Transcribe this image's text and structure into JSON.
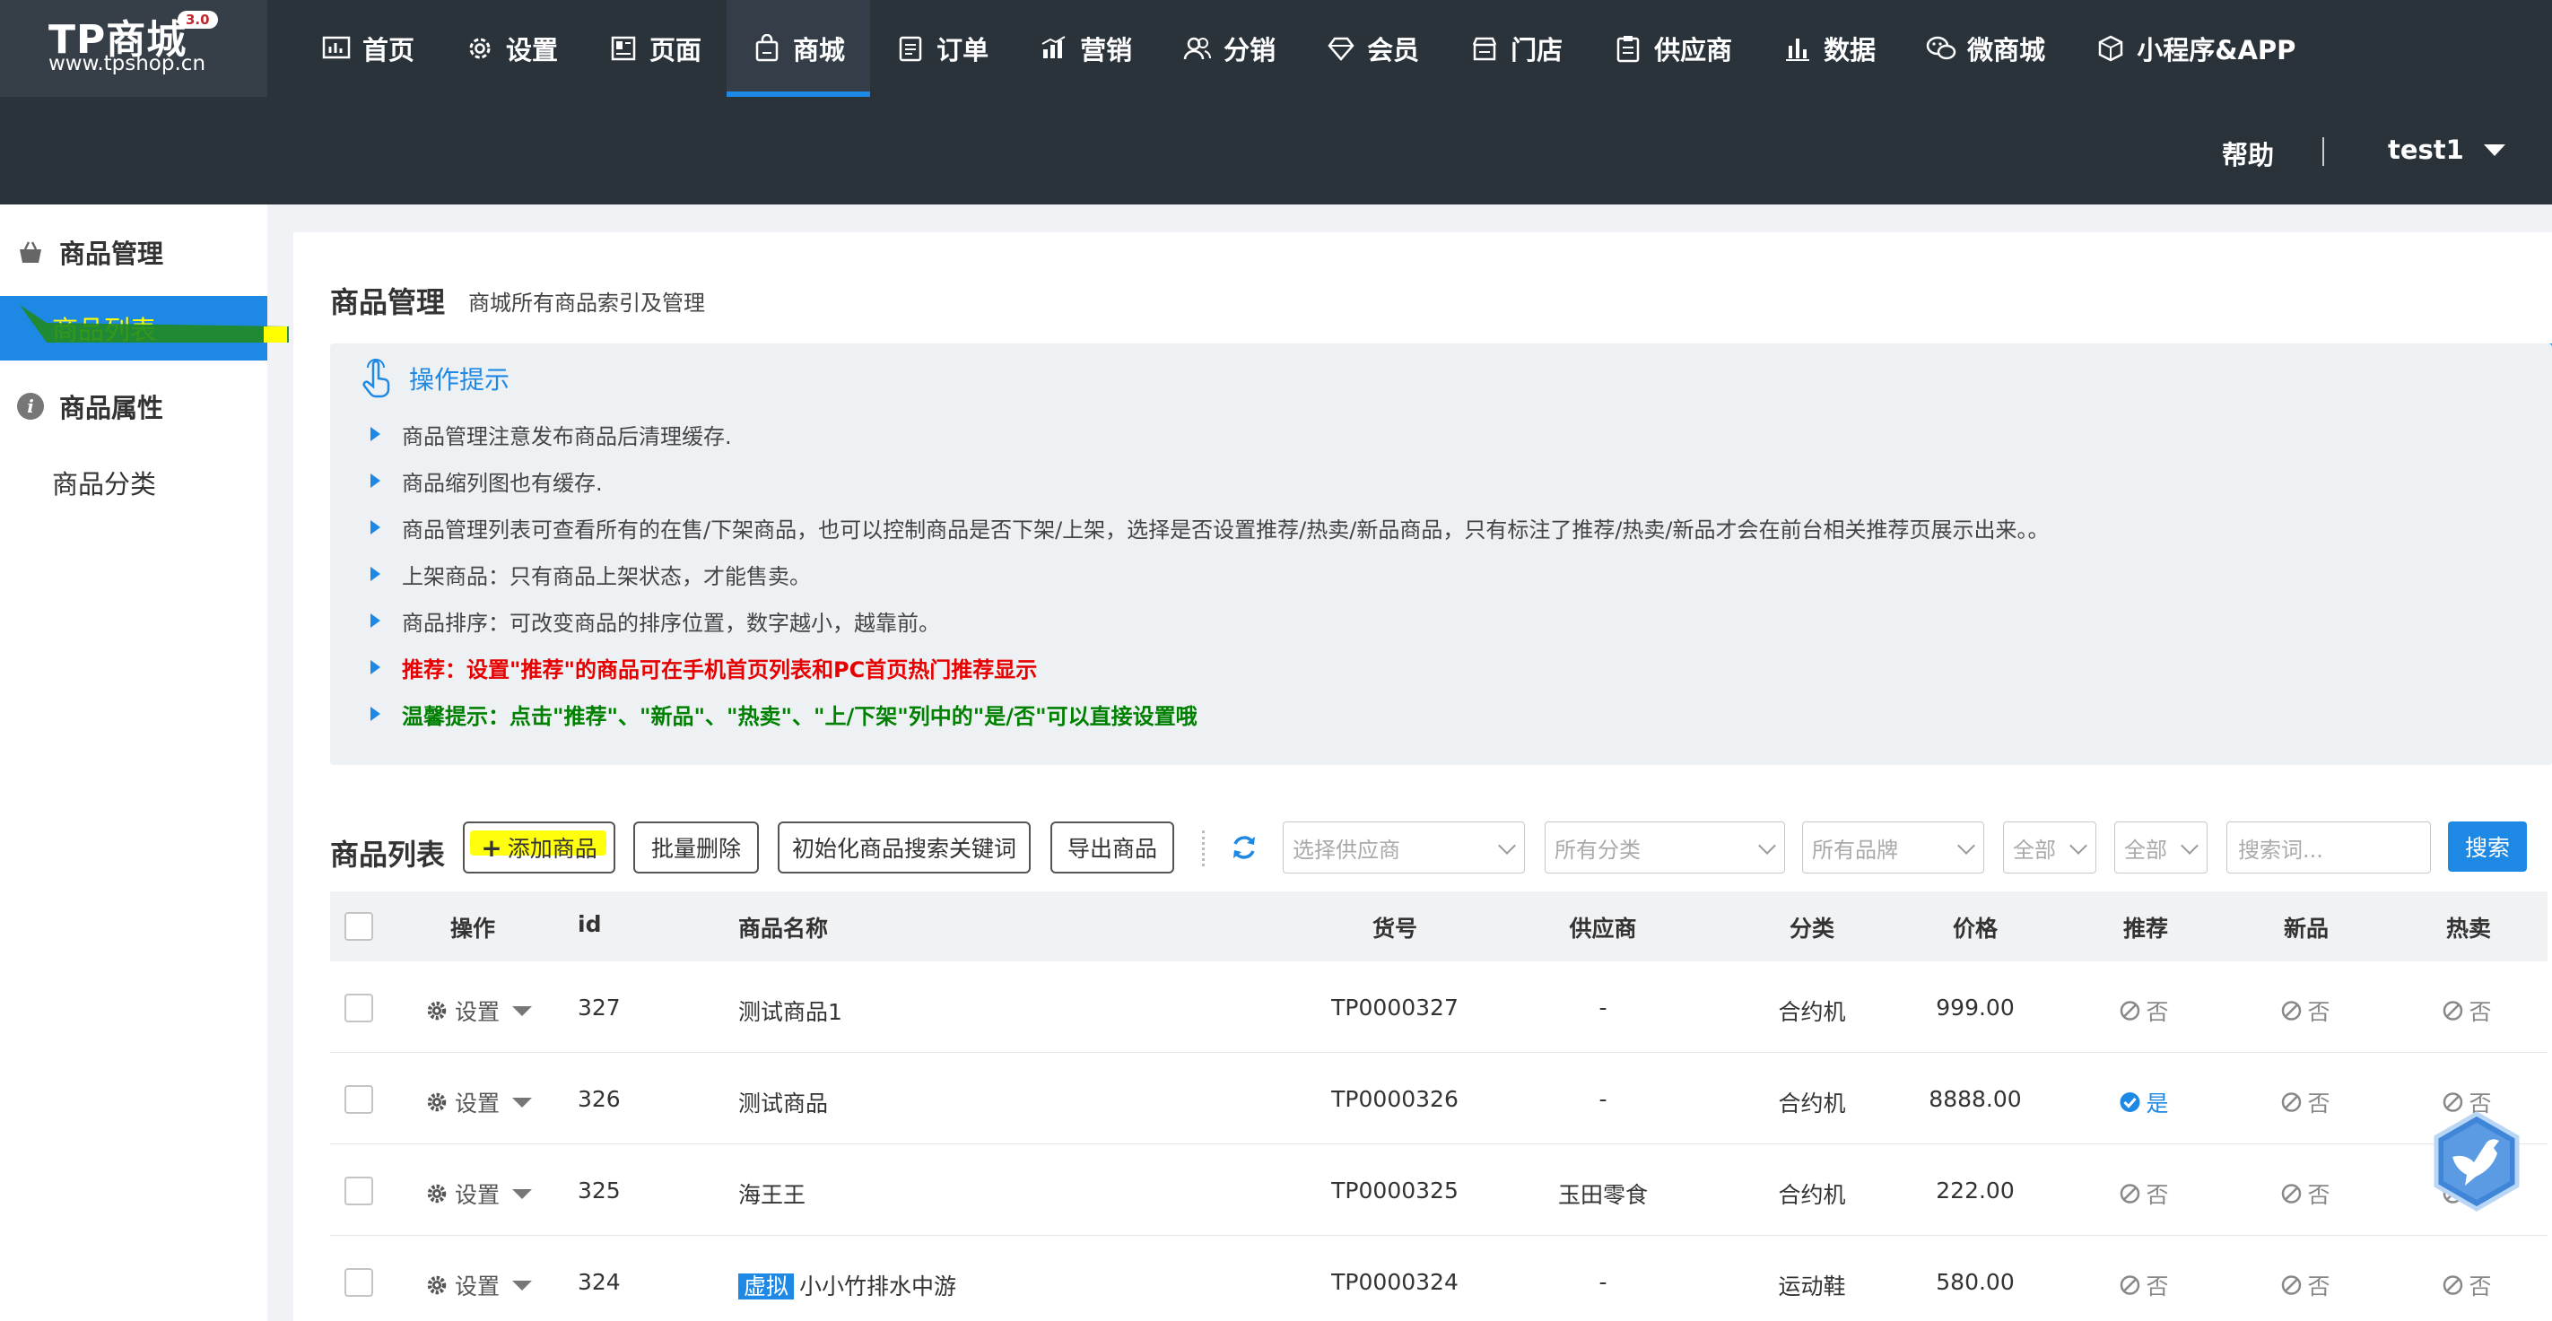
{
  "logo": {
    "name": "TP商城",
    "version": "3.0",
    "url": "www.tpshop.cn"
  },
  "nav": [
    {
      "label": "首页",
      "icon": "dashboard-icon"
    },
    {
      "label": "设置",
      "icon": "gear-icon"
    },
    {
      "label": "页面",
      "icon": "page-icon"
    },
    {
      "label": "商城",
      "icon": "shopping-bag-icon",
      "active": true
    },
    {
      "label": "订单",
      "icon": "order-list-icon"
    },
    {
      "label": "营销",
      "icon": "bar-chart-icon"
    },
    {
      "label": "分销",
      "icon": "users-icon"
    },
    {
      "label": "会员",
      "icon": "diamond-icon"
    },
    {
      "label": "门店",
      "icon": "store-icon"
    },
    {
      "label": "供应商",
      "icon": "clipboard-icon"
    },
    {
      "label": "数据",
      "icon": "stats-icon"
    },
    {
      "label": "微商城",
      "icon": "wechat-icon"
    },
    {
      "label": "小程序&APP",
      "icon": "cube-icon"
    }
  ],
  "header": {
    "help": "帮助",
    "user": "test1"
  },
  "sidebar": {
    "groups": [
      {
        "title": "商品管理",
        "icon": "basket-icon",
        "items": [
          {
            "label": "商品列表",
            "active": true
          }
        ]
      },
      {
        "title": "商品属性",
        "icon": "info-icon",
        "items": [
          {
            "label": "商品分类"
          }
        ]
      }
    ]
  },
  "page": {
    "title": "商品管理",
    "subtitle": "商城所有商品索引及管理"
  },
  "tips": {
    "title": "操作提示",
    "items": [
      {
        "text": "商品管理注意发布商品后清理缓存.",
        "style": "normal"
      },
      {
        "text": "商品缩列图也有缓存.",
        "style": "normal"
      },
      {
        "text": "商品管理列表可查看所有的在售/下架商品，也可以控制商品是否下架/上架，选择是否设置推荐/热卖/新品商品，只有标注了推荐/热卖/新品才会在前台相关推荐页展示出来。。",
        "style": "normal"
      },
      {
        "text": "上架商品：只有商品上架状态，才能售卖。",
        "style": "normal"
      },
      {
        "text": "商品排序：可改变商品的排序位置，数字越小，越靠前。",
        "style": "normal"
      },
      {
        "text": "推荐：设置\"推荐\"的商品可在手机首页列表和PC首页热门推荐显示",
        "style": "red"
      },
      {
        "text": "温馨提示：点击\"推荐\"、\"新品\"、\"热卖\"、\"上/下架\"列中的\"是/否\"可以直接设置哦",
        "style": "green"
      }
    ]
  },
  "toolbar": {
    "title": "商品列表",
    "add": "添加商品",
    "batch_delete": "批量删除",
    "init_keywords": "初始化商品搜索关键词",
    "export": "导出商品",
    "supplier_placeholder": "选择供应商",
    "category_placeholder": "所有分类",
    "brand_placeholder": "所有品牌",
    "filter1": "全部",
    "filter2": "全部",
    "search_placeholder": "搜索词...",
    "search": "搜索"
  },
  "table": {
    "columns": {
      "op": "操作",
      "id": "id",
      "name": "商品名称",
      "sku": "货号",
      "supplier": "供应商",
      "category": "分类",
      "price": "价格",
      "recommend": "推荐",
      "new": "新品",
      "hot": "热卖"
    },
    "settings_label": "设置",
    "yes": "是",
    "no": "否",
    "rows": [
      {
        "id": "327",
        "name": "测试商品1",
        "tag": "",
        "sku": "TP0000327",
        "supplier": "-",
        "category": "合约机",
        "price": "999.00",
        "recommend": "否",
        "new": "否",
        "hot": "否"
      },
      {
        "id": "326",
        "name": "测试商品",
        "tag": "",
        "sku": "TP0000326",
        "supplier": "-",
        "category": "合约机",
        "price": "8888.00",
        "recommend": "是",
        "new": "否",
        "hot": "否"
      },
      {
        "id": "325",
        "name": "海王王",
        "tag": "",
        "sku": "TP0000325",
        "supplier": "玉田零食",
        "category": "合约机",
        "price": "222.00",
        "recommend": "否",
        "new": "否",
        "hot": "否"
      },
      {
        "id": "324",
        "name": "小小竹排水中游",
        "tag": "虚拟",
        "sku": "TP0000324",
        "supplier": "-",
        "category": "运动鞋",
        "price": "580.00",
        "recommend": "否",
        "new": "否",
        "hot": "否"
      }
    ]
  },
  "colors": {
    "topbar": "#2a323a",
    "accent": "#1e88e5",
    "red": "#e60000",
    "green": "#008000",
    "highlight": "#ffff00"
  }
}
